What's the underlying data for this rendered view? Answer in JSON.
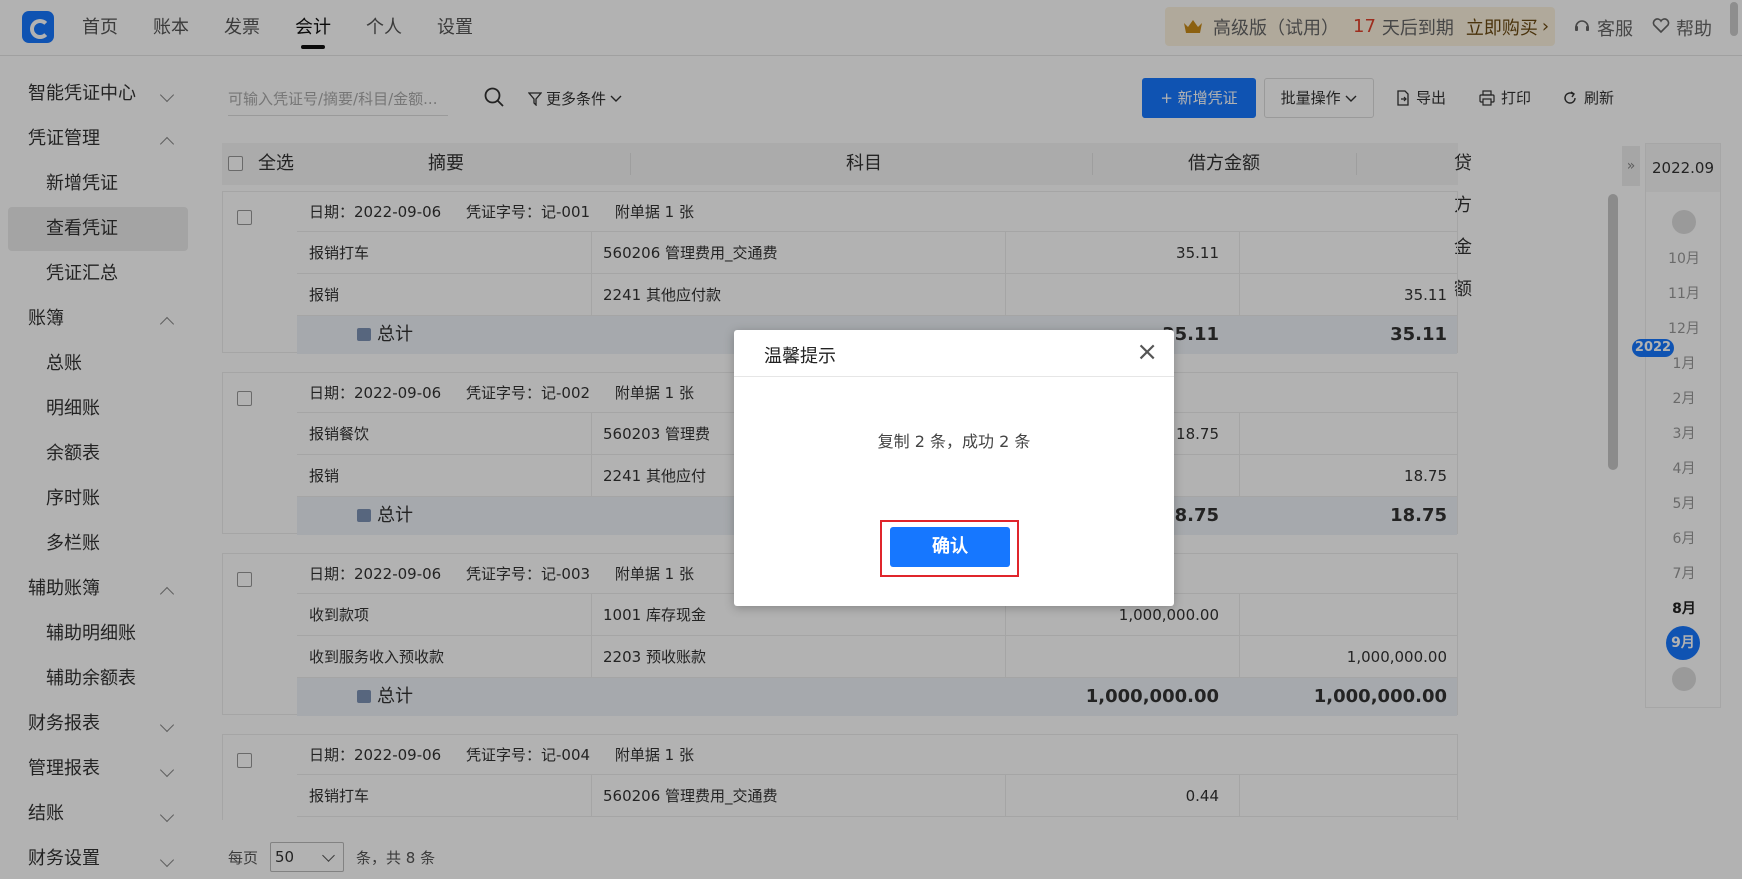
{
  "topnav": {
    "items": [
      "首页",
      "账本",
      "发票",
      "会计",
      "个人",
      "设置"
    ],
    "active": "会计"
  },
  "promo": {
    "edition": "高级版（试用）",
    "days": "17",
    "days_suffix": "天后到期",
    "buy": "立即购买",
    "buy_arrow": "›"
  },
  "header_links": {
    "support": "客服",
    "help": "帮助"
  },
  "sidebar": {
    "items": [
      {
        "label": "智能凭证中心",
        "type": "group",
        "expanded": false
      },
      {
        "label": "凭证管理",
        "type": "group",
        "expanded": true
      },
      {
        "label": "新增凭证",
        "type": "sub"
      },
      {
        "label": "查看凭证",
        "type": "sub",
        "active": true
      },
      {
        "label": "凭证汇总",
        "type": "sub"
      },
      {
        "label": "账簿",
        "type": "group",
        "expanded": true
      },
      {
        "label": "总账",
        "type": "sub"
      },
      {
        "label": "明细账",
        "type": "sub"
      },
      {
        "label": "余额表",
        "type": "sub"
      },
      {
        "label": "序时账",
        "type": "sub"
      },
      {
        "label": "多栏账",
        "type": "sub"
      },
      {
        "label": "辅助账簿",
        "type": "group",
        "expanded": true
      },
      {
        "label": "辅助明细账",
        "type": "sub"
      },
      {
        "label": "辅助余额表",
        "type": "sub"
      },
      {
        "label": "财务报表",
        "type": "group",
        "expanded": false
      },
      {
        "label": "管理报表",
        "type": "group",
        "expanded": false
      },
      {
        "label": "结账",
        "type": "group",
        "expanded": false
      },
      {
        "label": "财务设置",
        "type": "group",
        "expanded": false
      }
    ]
  },
  "toolbar": {
    "search_placeholder": "可输入凭证号/摘要/科目/金额...",
    "more_filters": "更多条件",
    "new_voucher": "新增凭证",
    "new_voucher_plus": "+",
    "batch": "批量操作",
    "export": "导出",
    "print": "打印",
    "refresh": "刷新"
  },
  "table": {
    "select_all": "全选",
    "columns": [
      "摘要",
      "科目",
      "借方金额",
      "贷方金额"
    ],
    "total_label": "总计",
    "date_label": "日期：",
    "voucher_label": "凭证字号：",
    "attach_prefix": "附单据",
    "attach_suffix": "张",
    "vouchers": [
      {
        "date": "2022-09-06",
        "no": "记-001",
        "attachments": "1",
        "rows": [
          {
            "summary": "报销打车",
            "account": "560206 管理费用_交通费",
            "debit": "35.11",
            "credit": ""
          },
          {
            "summary": "报销",
            "account": "2241 其他应付款",
            "debit": "",
            "credit": "35.11"
          }
        ],
        "total_debit": "35.11",
        "total_credit": "35.11"
      },
      {
        "date": "2022-09-06",
        "no": "记-002",
        "attachments": "1",
        "rows": [
          {
            "summary": "报销餐饮",
            "account": "560203 管理费",
            "debit": "18.75",
            "credit": ""
          },
          {
            "summary": "报销",
            "account": "2241 其他应付",
            "debit": "",
            "credit": "18.75"
          }
        ],
        "total_debit": "18.75",
        "total_credit": "18.75"
      },
      {
        "date": "2022-09-06",
        "no": "记-003",
        "attachments": "1",
        "rows": [
          {
            "summary": "收到款项",
            "account": "1001 库存现金",
            "debit": "1,000,000.00",
            "credit": ""
          },
          {
            "summary": "收到服务收入预收款",
            "account": "2203 预收账款",
            "debit": "",
            "credit": "1,000,000.00"
          }
        ],
        "total_debit": "1,000,000.00",
        "total_credit": "1,000,000.00"
      },
      {
        "date": "2022-09-06",
        "no": "记-004",
        "attachments": "1",
        "rows": [
          {
            "summary": "报销打车",
            "account": "560206 管理费用_交通费",
            "debit": "0.44",
            "credit": ""
          }
        ],
        "total_debit": "",
        "total_credit": ""
      }
    ]
  },
  "pager": {
    "per_page_label": "每页",
    "per_page": "50",
    "total_text": "条，共 8 条"
  },
  "timeline": {
    "period": "2022.09",
    "year": "2022",
    "months": [
      "10月",
      "11月",
      "12月",
      "1月",
      "2月",
      "3月",
      "4月",
      "5月",
      "6月",
      "7月",
      "8月",
      "9月"
    ],
    "current": "9月"
  },
  "dialog": {
    "title": "温馨提示",
    "close": "×",
    "message": "复制 2 条，成功 2 条",
    "confirm": "确认"
  },
  "colors": {
    "primary": "#1677ff",
    "highlight": "#e0252b",
    "promo_bg": "#fdf3df",
    "days": "#e1412c"
  }
}
